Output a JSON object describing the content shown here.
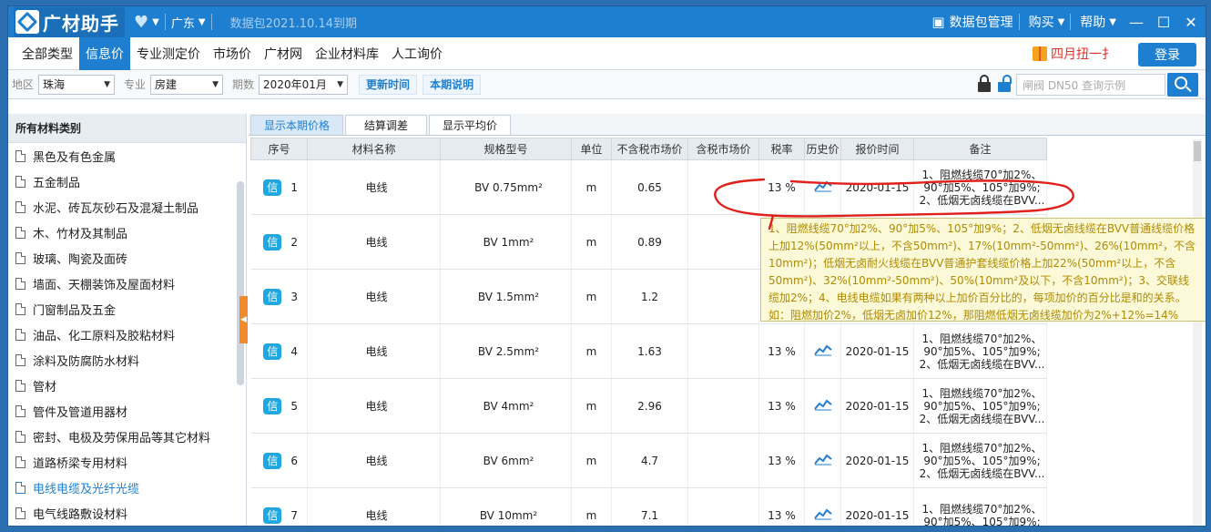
{
  "app": {
    "title": "广材助手",
    "region": "广东",
    "expire_note": "数据包2021.10.14到期",
    "top_menu": {
      "package_mgmt": "数据包管理",
      "buy": "购买",
      "help": "帮助"
    }
  },
  "nav": {
    "tabs": [
      "全部类型",
      "信息价",
      "专业测定价",
      "市场价",
      "广材网",
      "企业材料库",
      "人工询价"
    ],
    "active_index": 1,
    "promo": "四月扭一扌",
    "login": "登录"
  },
  "filters": {
    "region_label": "地区",
    "region_value": "珠海",
    "major_label": "专业",
    "major_value": "房建",
    "period_label": "期数",
    "period_value": "2020年01月",
    "update_time_btn": "更新时间",
    "period_note_btn": "本期说明",
    "search_placeholder": "闸阀 DN50 查询示例"
  },
  "sidebar": {
    "title": "所有材料类别",
    "active_index": 14,
    "items": [
      "黑色及有色金属",
      "五金制品",
      "水泥、砖瓦灰砂石及混凝土制品",
      "木、竹材及其制品",
      "玻璃、陶瓷及面砖",
      "墙面、天棚装饰及屋面材料",
      "门窗制品及五金",
      "油品、化工原料及胶粘材料",
      "涂料及防腐防水材料",
      "管材",
      "管件及管道用器材",
      "密封、电极及劳保用品等其它材料",
      "道路桥梁专用材料",
      "电线电缆及光纤光缆",
      "电气线路敷设材料"
    ]
  },
  "subtabs": [
    "显示本期价格",
    "结算调差",
    "显示平均价"
  ],
  "table": {
    "headers": [
      "序号",
      "材料名称",
      "规格型号",
      "单位",
      "不含税市场价",
      "含税市场价",
      "税率",
      "历史价",
      "报价时间",
      "备注"
    ],
    "badge": "信",
    "rows": [
      {
        "seq": "1",
        "name": "电线",
        "spec": "BV 0.75mm²",
        "unit": "m",
        "price": "0.65",
        "tax_price": "",
        "tax": "13 %",
        "date": "2020-01-15",
        "note": [
          "1、阻燃线缆70°加2%、",
          "90°加5%、105°加9%;",
          "2、低烟无卤线缆在BVV..."
        ]
      },
      {
        "seq": "2",
        "name": "电线",
        "spec": "BV 1mm²",
        "unit": "m",
        "price": "0.89",
        "tax_price": "",
        "tax": "",
        "date": "",
        "note": [
          "",
          "",
          ""
        ]
      },
      {
        "seq": "3",
        "name": "电线",
        "spec": "BV 1.5mm²",
        "unit": "m",
        "price": "1.2",
        "tax_price": "",
        "tax": "",
        "date": "",
        "note": [
          "",
          "",
          ""
        ]
      },
      {
        "seq": "4",
        "name": "电线",
        "spec": "BV 2.5mm²",
        "unit": "m",
        "price": "1.63",
        "tax_price": "",
        "tax": "13 %",
        "date": "2020-01-15",
        "note": [
          "1、阻燃线缆70°加2%、",
          "90°加5%、105°加9%;",
          "2、低烟无卤线缆在BVV..."
        ]
      },
      {
        "seq": "5",
        "name": "电线",
        "spec": "BV 4mm²",
        "unit": "m",
        "price": "2.96",
        "tax_price": "",
        "tax": "13 %",
        "date": "2020-01-15",
        "note": [
          "1、阻燃线缆70°加2%、",
          "90°加5%、105°加9%;",
          "2、低烟无卤线缆在BVV..."
        ]
      },
      {
        "seq": "6",
        "name": "电线",
        "spec": "BV 6mm²",
        "unit": "m",
        "price": "4.7",
        "tax_price": "",
        "tax": "13 %",
        "date": "2020-01-15",
        "note": [
          "1、阻燃线缆70°加2%、",
          "90°加5%、105°加9%;",
          "2、低烟无卤线缆在BVV..."
        ]
      },
      {
        "seq": "7",
        "name": "电线",
        "spec": "BV 10mm²",
        "unit": "m",
        "price": "7.1",
        "tax_price": "",
        "tax": "13 %",
        "date": "2020-01-15",
        "note": [
          "1、阻燃线缆70°加2%、",
          "90°加5%、105°加9%;",
          ""
        ]
      }
    ]
  },
  "tooltip": {
    "text": "1、阻燃线缆70°加2%、90°加5%、105°加9%；2、低烟无卤线缆在BVV普通线缆价格上加12%(50mm²以上，不含50mm²)、17%(10mm²-50mm²)、26%(10mm²，不含10mm²)；低烟无卤耐火线缆在BVV普通护套线缆价格上加22%(50mm²以上，不含50mm²)、32%(10mm²-50mm²)、50%(10mm²及以下，不含10mm²)；3、交联线缆加2%；4、电线电缆如果有两种以上加价百分比的，每项加价的百分比是和的关系。如：阻燃加价2%，低烟无卤加价12%，那阻燃低烟无卤线缆加价为2%+12%=14%"
  },
  "colors": {
    "brand": "#1e7fd0",
    "accent_orange": "#f08a2b",
    "annotation_red": "#e0201a",
    "tooltip_bg": "#fbf9d8"
  }
}
